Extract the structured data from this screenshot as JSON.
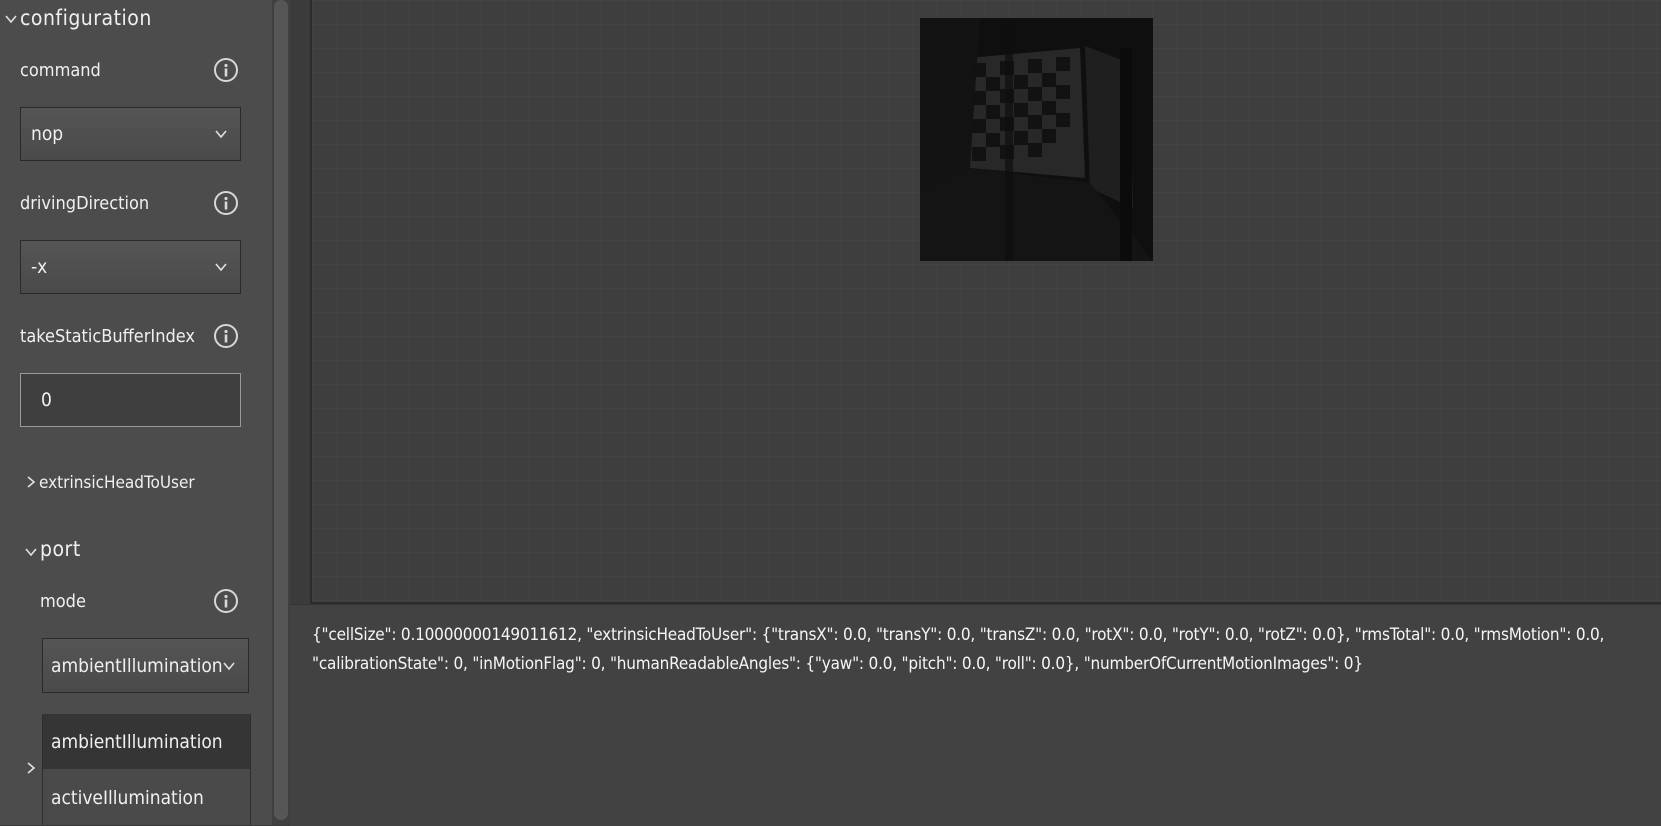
{
  "configuration": {
    "title": "configuration",
    "command": {
      "label": "command",
      "value": "nop"
    },
    "drivingDirection": {
      "label": "drivingDirection",
      "value": "-x"
    },
    "takeStaticBufferIndex": {
      "label": "takeStaticBufferIndex",
      "value": "0"
    },
    "extrinsicHeadToUser": {
      "label": "extrinsicHeadToUser"
    },
    "port": {
      "label": "port",
      "mode": {
        "label": "mode",
        "value": "ambientIllumination",
        "options": [
          "ambientIllumination",
          "activeIllumination"
        ]
      }
    }
  },
  "output": {
    "json_text": "{\"cellSize\": 0.10000000149011612, \"extrinsicHeadToUser\": {\"transX\": 0.0, \"transY\": 0.0, \"transZ\": 0.0, \"rotX\": 0.0, \"rotY\": 0.0, \"rotZ\": 0.0}, \"rmsTotal\": 0.0, \"rmsMotion\": 0.0, \"calibrationState\": 0, \"inMotionFlag\": 0, \"humanReadableAngles\": {\"yaw\": 0.0, \"pitch\": 0.0, \"roll\": 0.0}, \"numberOfCurrentMotionImages\": 0}"
  },
  "icons": {
    "expanded": "chevron-down-icon",
    "collapsed": "chevron-right-icon",
    "info": "info-icon",
    "dropdown": "chevron-down-icon"
  },
  "colors": {
    "panel_bg": "#4c4c4c",
    "viewer_bg": "#3e3e3e",
    "output_bg": "#424242",
    "text": "#f0f0f0"
  }
}
